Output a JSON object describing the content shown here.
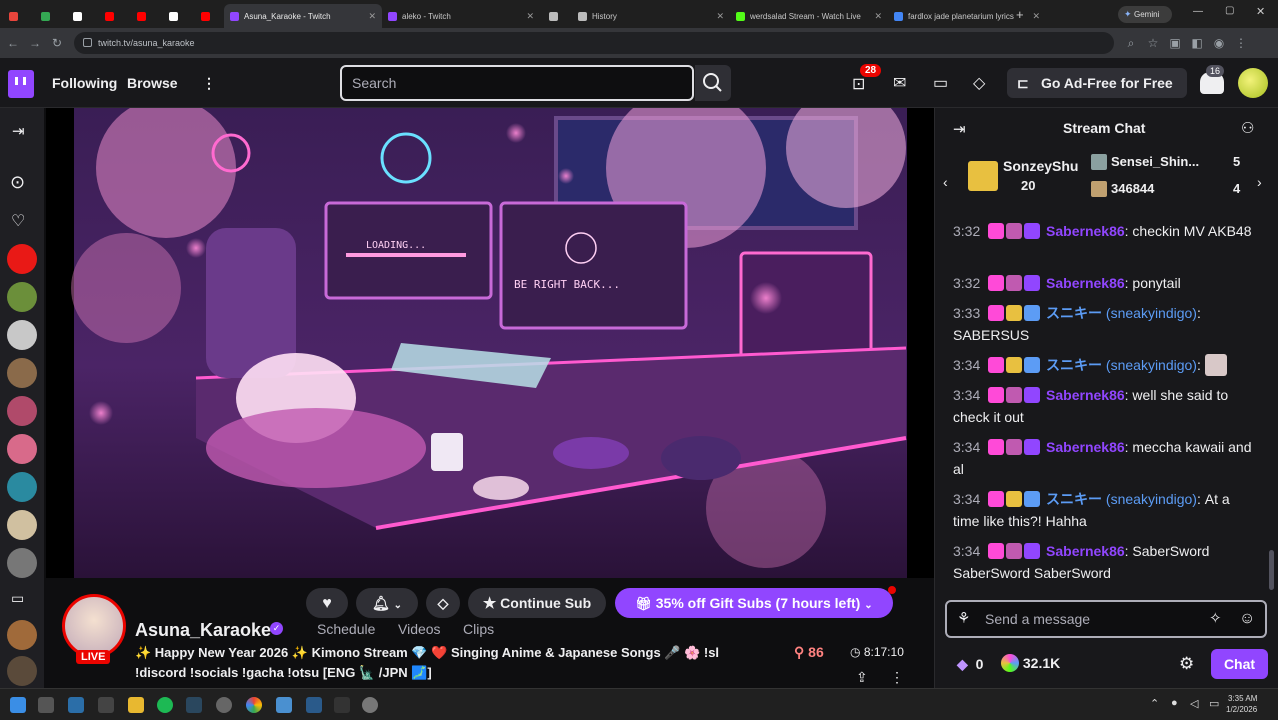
{
  "browser": {
    "tabs": [
      {
        "title": "",
        "color": "#e8453c"
      },
      {
        "title": "",
        "color": "#34a853"
      },
      {
        "title": "",
        "color": "#ffffff"
      },
      {
        "title": "",
        "color": "#ff0000"
      },
      {
        "title": "",
        "color": "#ff0000"
      },
      {
        "title": "",
        "color": "#ffffff"
      },
      {
        "title": "",
        "color": "#ff0000"
      },
      {
        "title": "Asuna_Karaoke - Twitch",
        "color": "#9146ff"
      },
      {
        "title": "aleko - Twitch",
        "color": "#9146ff"
      },
      {
        "title": "",
        "color": "#bbbbbb"
      },
      {
        "title": "History",
        "color": "#bbbbbb"
      },
      {
        "title": "werdsalad Stream - Watch Live",
        "color": "#53fc18"
      },
      {
        "title": "fardlox jade planetarium lyrics",
        "color": "#4285f4"
      }
    ],
    "new_tab": "+",
    "gemini_label": "Gemini",
    "url": "twitch.tv/asuna_karaoke"
  },
  "twitch_nav": {
    "following": "Following",
    "browse": "Browse",
    "more": "⋮",
    "search_placeholder": "Search",
    "notifications_count": "28",
    "ad_free": "Go Ad-Free for Free",
    "avatar_badge": "16"
  },
  "stream": {
    "channel": "Asuna_Karaoke",
    "live": "LIVE",
    "title_line1": "✨ Happy New Year 2026 ✨ Kimono Stream 💎 ❤️ Singing Anime & Japanese Songs 🎤 🌸 !sl",
    "title_line2": "!discord !socials !gacha !otsu [ENG 🗽 /JPN 🗾]",
    "viewers": "86",
    "uptime": "8:17:10",
    "continue_sub": "Continue Sub",
    "gift_subs": "35% off Gift Subs (7 hours left)",
    "tabs": [
      "Schedule",
      "Videos",
      "Clips"
    ]
  },
  "chat": {
    "header": "Stream Chat",
    "leaders": [
      {
        "name": "SonzeyShu",
        "value": "20"
      },
      {
        "name": "Sensei_Shin...",
        "value": "5"
      },
      {
        "name": "346844",
        "value": "4"
      }
    ],
    "messages": [
      {
        "time": "3:32",
        "user": "Sabernek86",
        "text": ": checkin MV AKB48",
        "color": "#9146ff"
      },
      {
        "time": "3:32",
        "user": "Sabernek86",
        "text": ": ponytail",
        "color": "#9146ff"
      },
      {
        "time": "3:33",
        "user": "スニキー",
        "handle": "(sneakyindigo)",
        "text": ": SABERSUS",
        "color": "#5c9cf5"
      },
      {
        "time": "3:34",
        "user": "スニキー",
        "handle": "(sneakyindigo)",
        "text": ":",
        "color": "#5c9cf5"
      },
      {
        "time": "3:34",
        "user": "Sabernek86",
        "text": ": well she said to check it out",
        "color": "#9146ff"
      },
      {
        "time": "3:34",
        "user": "Sabernek86",
        "text": ": meccha kawaii and al",
        "color": "#9146ff"
      },
      {
        "time": "3:34",
        "user": "スニキー",
        "handle": "(sneakyindigo)",
        "text": ": At a time like this?! Hahha",
        "color": "#5c9cf5"
      },
      {
        "time": "3:34",
        "user": "Sabernek86",
        "text": ": SaberSword SaberSword SaberSword",
        "color": "#9146ff"
      }
    ],
    "input_placeholder": "Send a message",
    "bits": "0",
    "points": "32.1K",
    "chat_button": "Chat"
  },
  "taskbar": {
    "time": "3:35 AM",
    "date": "1/2/2026"
  }
}
